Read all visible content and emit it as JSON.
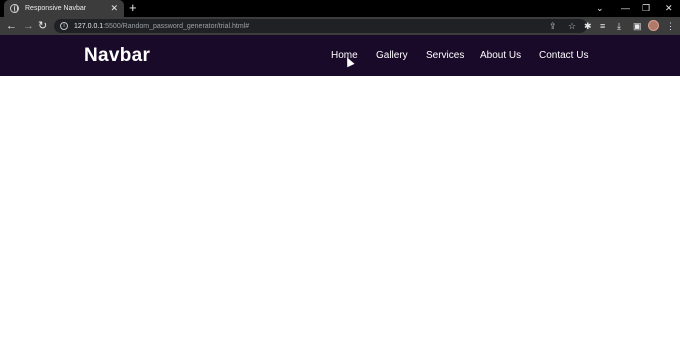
{
  "browser": {
    "tab": {
      "title": "Responsive Navbar",
      "close": "✕"
    },
    "new_tab": "+",
    "window": {
      "tab_search": "⌄",
      "minimize": "—",
      "restore": "❐",
      "close": "✕"
    },
    "toolbar": {
      "back": "←",
      "forward": "→",
      "reload": "↻",
      "menu": "⋮"
    },
    "address": {
      "host": "127.0.0.1",
      "path": ":5500/Random_password_generator/trial.html#"
    },
    "icons": {
      "favicon": "globe-icon",
      "info": "info-icon",
      "share": "share-icon",
      "star": "star-icon",
      "extensions": "puzzle-icon",
      "reading_list": "reading-list-icon",
      "downloads": "download-icon",
      "side_panel": "side-panel-icon"
    }
  },
  "site": {
    "brand": "Navbar",
    "links": [
      "Home",
      "Gallery",
      "Services",
      "About Us",
      "Contact Us"
    ],
    "colors": {
      "nav_background": "#1a0a2a",
      "text": "#ffffff",
      "page_background": "#ffffff"
    }
  }
}
